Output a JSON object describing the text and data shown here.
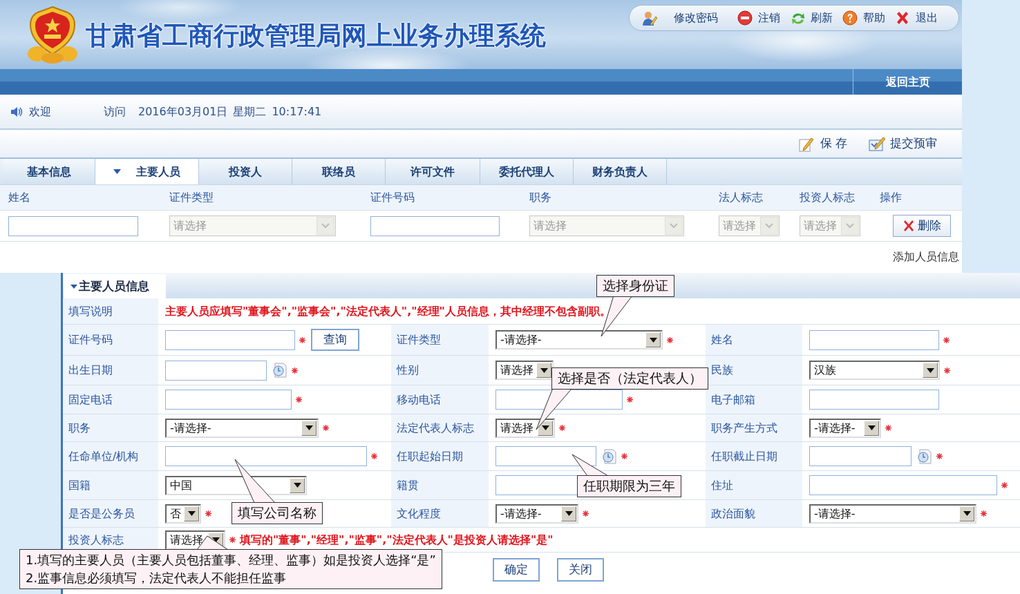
{
  "header": {
    "title": "甘肃省工商行政管理局网上业务办理系统"
  },
  "toolbar": [
    {
      "label": "修改密码"
    },
    {
      "label": "注销"
    },
    {
      "label": "刷新"
    },
    {
      "label": "帮助"
    },
    {
      "label": "退出"
    }
  ],
  "nav": {
    "home": "返回主页"
  },
  "welcome": {
    "greeting": "欢迎",
    "visit": "访问",
    "date": "2016年03月01日",
    "weekday": "星期二",
    "time": "10:17:41"
  },
  "actions": [
    {
      "label": "保 存"
    },
    {
      "label": "提交预审"
    }
  ],
  "tabs": [
    {
      "label": "基本信息",
      "selected": false
    },
    {
      "label": "主要人员",
      "selected": true
    },
    {
      "label": "投资人",
      "selected": false
    },
    {
      "label": "联络员",
      "selected": false
    },
    {
      "label": "许可文件",
      "selected": false
    },
    {
      "label": "委托代理人",
      "selected": false
    },
    {
      "label": "财务负责人",
      "selected": false
    }
  ],
  "table": {
    "columns": [
      "姓名",
      "证件类型",
      "证件号码",
      "职务",
      "法人标志",
      "投资人标志",
      "操作"
    ],
    "row": [
      {
        "kind": "text"
      },
      {
        "kind": "select",
        "placeholder": "请选择",
        "disabled": true
      },
      {
        "kind": "text"
      },
      {
        "kind": "select",
        "placeholder": "请选择",
        "disabled": true
      },
      {
        "kind": "select",
        "placeholder": "请选择",
        "disabled": true
      },
      {
        "kind": "select",
        "placeholder": "请选择",
        "disabled": true
      },
      {
        "kind": "button",
        "label": "删除"
      }
    ]
  },
  "add_link": "添加人员信息",
  "dialog": {
    "title": "主要人员信息",
    "note": {
      "label": "填写说明",
      "text": "主要人员应填写\"董事会\",\"监事会\",\"法定代表人\",\"经理\"人员信息，其中经理不包含副职。"
    },
    "rows": [
      [
        {
          "label": "证件号码",
          "field": {
            "kind": "text",
            "required": true,
            "button": "查询"
          }
        },
        {
          "label": "证件类型",
          "field": {
            "kind": "select",
            "value": "-请选择-",
            "required": true
          }
        },
        {
          "label": "姓名",
          "field": {
            "kind": "text",
            "required": true
          }
        }
      ],
      [
        {
          "label": "出生日期",
          "field": {
            "kind": "date",
            "required": true
          }
        },
        {
          "label": "性别",
          "field": {
            "kind": "select",
            "value": "请选择"
          }
        },
        {
          "label": "民族",
          "field": {
            "kind": "select",
            "value": "汉族",
            "required": true
          }
        }
      ],
      [
        {
          "label": "固定电话",
          "field": {
            "kind": "text",
            "required": true
          }
        },
        {
          "label": "移动电话",
          "field": {
            "kind": "text",
            "required": true
          }
        },
        {
          "label": "电子邮箱",
          "field": {
            "kind": "text"
          }
        }
      ],
      [
        {
          "label": "职务",
          "field": {
            "kind": "select",
            "value": "-请选择-",
            "required": true
          }
        },
        {
          "label": "法定代表人标志",
          "field": {
            "kind": "select",
            "value": "请选择",
            "required": true
          }
        },
        {
          "label": "职务产生方式",
          "field": {
            "kind": "select",
            "value": "-请选择-",
            "required": true
          }
        }
      ],
      [
        {
          "label": "任命单位/机构",
          "field": {
            "kind": "text",
            "required": true
          }
        },
        {
          "label": "任职起始日期",
          "field": {
            "kind": "date",
            "required": true
          }
        },
        {
          "label": "任职截止日期",
          "field": {
            "kind": "date",
            "required": true
          }
        }
      ],
      [
        {
          "label": "国籍",
          "field": {
            "kind": "select",
            "value": "中国"
          }
        },
        {
          "label": "籍贯",
          "field": {
            "kind": "text"
          }
        },
        {
          "label": "住址",
          "field": {
            "kind": "text",
            "required": true
          }
        }
      ],
      [
        {
          "label": "是否是公务员",
          "field": {
            "kind": "select",
            "value": "否",
            "required": true
          }
        },
        {
          "label": "文化程度",
          "field": {
            "kind": "select",
            "value": "-请选择-",
            "required": true
          }
        },
        {
          "label": "政治面貌",
          "field": {
            "kind": "select",
            "value": "-请选择-",
            "required": true
          }
        }
      ]
    ],
    "investor": {
      "label": "投资人标志",
      "field": {
        "kind": "select",
        "value": "请选择",
        "required": true
      },
      "note": "填写的\"董事\",\"经理\",\"监事\",\"法定代表人\"是投资人请选择\"是\""
    },
    "buttons": [
      "确定",
      "关闭"
    ]
  },
  "callouts": [
    {
      "lines": [
        "选择身份证"
      ]
    },
    {
      "lines": [
        "选择是否（法定代表人）"
      ]
    },
    {
      "lines": [
        "任职期限为三年"
      ]
    },
    {
      "lines": [
        "填写公司名称"
      ]
    },
    {
      "lines": [
        "1.填写的主要人员（主要人员包括董事、经理、监事）如是投资人选择“是”",
        "2.监事信息必须填写，法定代表人不能担任监事"
      ]
    }
  ]
}
